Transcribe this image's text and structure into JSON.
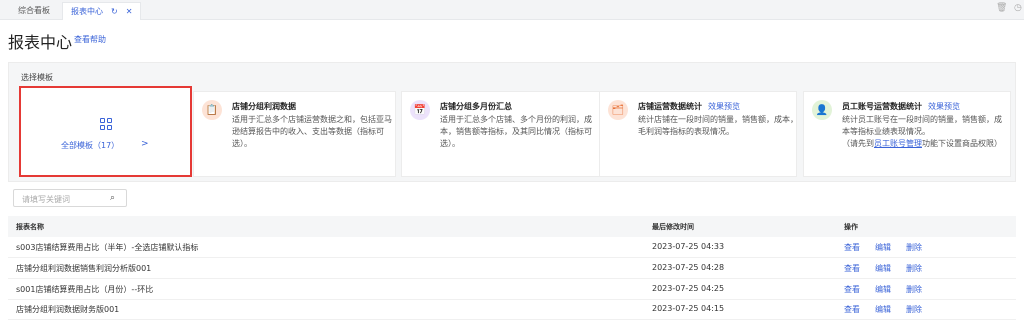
{
  "tabs": [
    {
      "label": "综合看板"
    },
    {
      "label": "报表中心"
    }
  ],
  "tab_icons": {
    "refresh": "↻",
    "close": "✕"
  },
  "topright_icons": {
    "trash": "🗑",
    "clock": "◷"
  },
  "header": {
    "title": "报表中心",
    "help": "查看帮助"
  },
  "templates": {
    "section_label": "选择模板",
    "all_label": "全部模板（17）",
    "chevron": ">",
    "items": [
      {
        "title": "店铺分组利润数据",
        "preview": "",
        "desc": "适用于汇总多个店铺运营数据之和，包括亚马逊结算报告中的收入、支出等数据（指标可选）。",
        "icon": "📋"
      },
      {
        "title": "店铺分组多月份汇总",
        "preview": "",
        "desc": "适用于汇总多个店铺、多个月份的利润，成本，销售额等指标，及其同比情况（指标可选）。",
        "icon": "📅"
      },
      {
        "title": "店铺运营数据统计",
        "preview": "效果预览",
        "desc": "统计店铺在一段时间的销量，销售额，成本，毛利润等指标的表现情况。",
        "icon": "🗂"
      },
      {
        "title": "员工账号运营数据统计",
        "preview": "效果预览",
        "desc": "统计员工账号在一段时间的销量，销售额，成本等指标业绩表现情况。",
        "desc2_pre": "（请先到",
        "desc2_link": "员工账号管理",
        "desc2_post": "功能下设置商品权限）",
        "icon": "👤"
      }
    ]
  },
  "search": {
    "placeholder": "请填写关键词",
    "icon": "⌕"
  },
  "table": {
    "headers": {
      "name": "报表名称",
      "modified": "最后修改时间",
      "ops": "操作"
    },
    "actions": {
      "view": "查看",
      "edit": "编辑",
      "delete": "删除"
    },
    "rows": [
      {
        "name": "s003店铺结算费用占比（半年）-全选店铺默认指标",
        "time": "2023-07-25 04:33"
      },
      {
        "name": "店铺分组利润数据销售利润分析版001",
        "time": "2023-07-25 04:28"
      },
      {
        "name": "s001店铺结算费用占比（月份）--环比",
        "time": "2023-07-25 04:25"
      },
      {
        "name": "店铺分组利润数据财务版001",
        "time": "2023-07-25 04:15"
      }
    ]
  },
  "colors": {
    "accent": "#3a63d8",
    "highlight": "#e53935"
  }
}
